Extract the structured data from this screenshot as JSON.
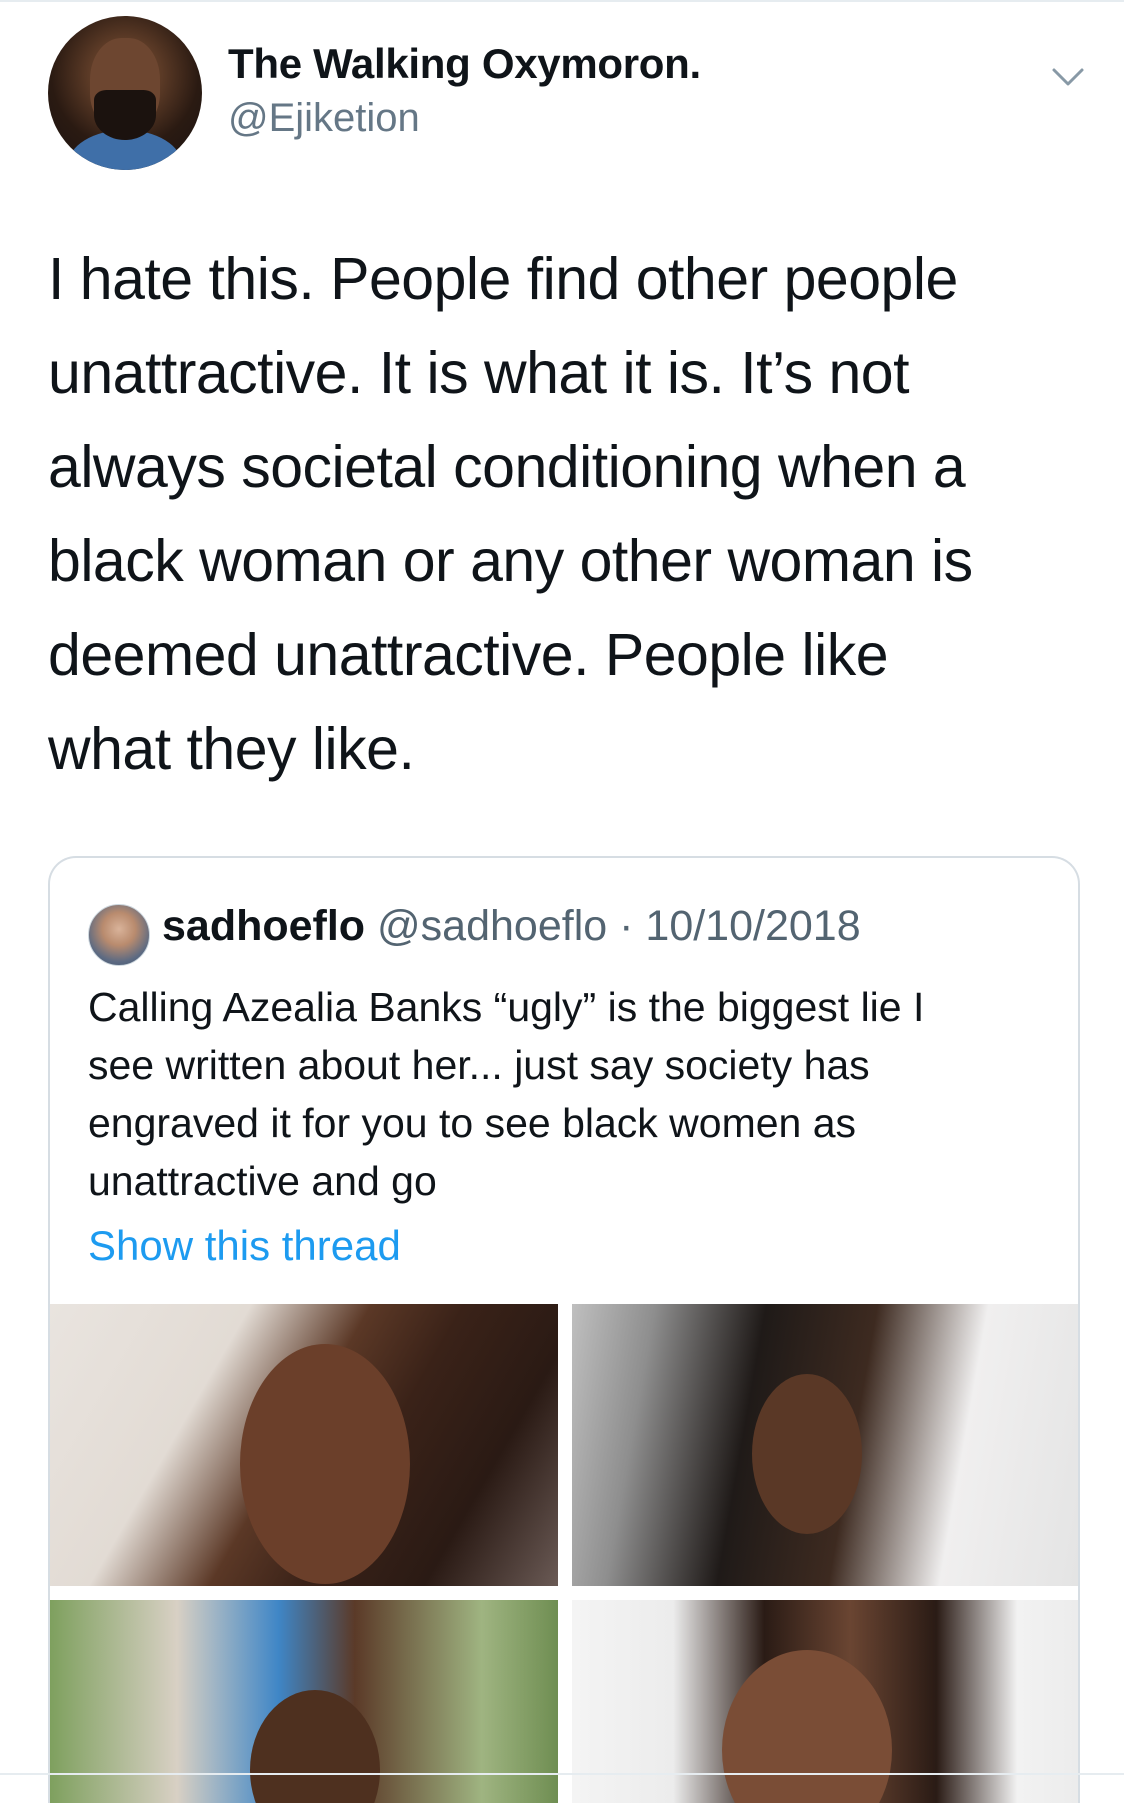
{
  "tweet": {
    "author_name": "The Walking Oxymoron.",
    "author_handle": "@Ejiketion",
    "avatar_icon": "profile-photo",
    "menu_icon": "chevron-down-icon",
    "text_lines": [
      "I hate this. People find other people",
      "unattractive. It is what it is. It’s not",
      "always societal conditioning when a",
      "black woman or any other woman is",
      "deemed unattractive. People like",
      "what they like."
    ]
  },
  "quoted_tweet": {
    "author_name": "sadhoeflo",
    "author_handle": "@sadhoeflo",
    "separator": "·",
    "date": "10/10/2018",
    "text_lines": [
      "Calling Azealia Banks “ugly” is the biggest lie I",
      "see written about her... just say society has",
      "engraved it for you to see black women as",
      "unattractive and go"
    ],
    "show_thread_label": "Show this thread",
    "link_color": "#1d9bf0",
    "media_count": 4
  }
}
